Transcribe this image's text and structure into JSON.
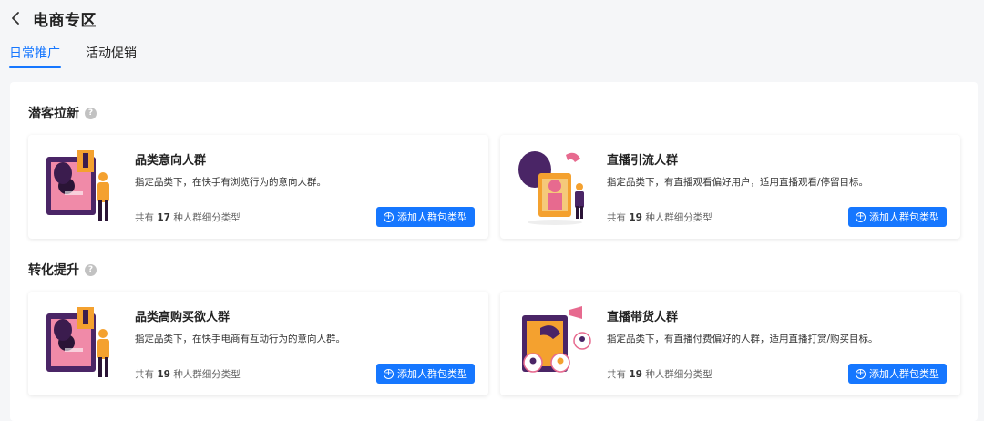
{
  "header": {
    "title": "电商专区",
    "back_icon": "chevron-left-icon"
  },
  "tabs": [
    {
      "label": "日常推广",
      "active": true
    },
    {
      "label": "活动促销",
      "active": false
    }
  ],
  "colors": {
    "accent": "#1677ff",
    "background": "#f5f6f8",
    "illustration_purple": "#5b2d6e",
    "illustration_orange": "#f4a12f",
    "illustration_pink": "#e76a8f"
  },
  "sections": [
    {
      "title": "潜客拉新",
      "help_icon": "question-circle-icon",
      "cards": [
        {
          "title": "品类意向人群",
          "description": "指定品类下，在快手有浏览行为的意向人群。",
          "count_prefix": "共有",
          "count": "17",
          "count_suffix": "种人群细分类型",
          "button_label": "添加人群包类型"
        },
        {
          "title": "直播引流人群",
          "description": "指定品类下，有直播观看偏好用户，适用直播观看/停留目标。",
          "count_prefix": "共有",
          "count": "19",
          "count_suffix": "种人群细分类型",
          "button_label": "添加人群包类型"
        }
      ]
    },
    {
      "title": "转化提升",
      "help_icon": "question-circle-icon",
      "cards": [
        {
          "title": "品类高购买欲人群",
          "description": "指定品类下，在快手电商有互动行为的意向人群。",
          "count_prefix": "共有",
          "count": "19",
          "count_suffix": "种人群细分类型",
          "button_label": "添加人群包类型"
        },
        {
          "title": "直播带货人群",
          "description": "指定品类下，有直播付费偏好的人群，适用直播打赏/购买目标。",
          "count_prefix": "共有",
          "count": "19",
          "count_suffix": "种人群细分类型",
          "button_label": "添加人群包类型"
        }
      ]
    }
  ]
}
